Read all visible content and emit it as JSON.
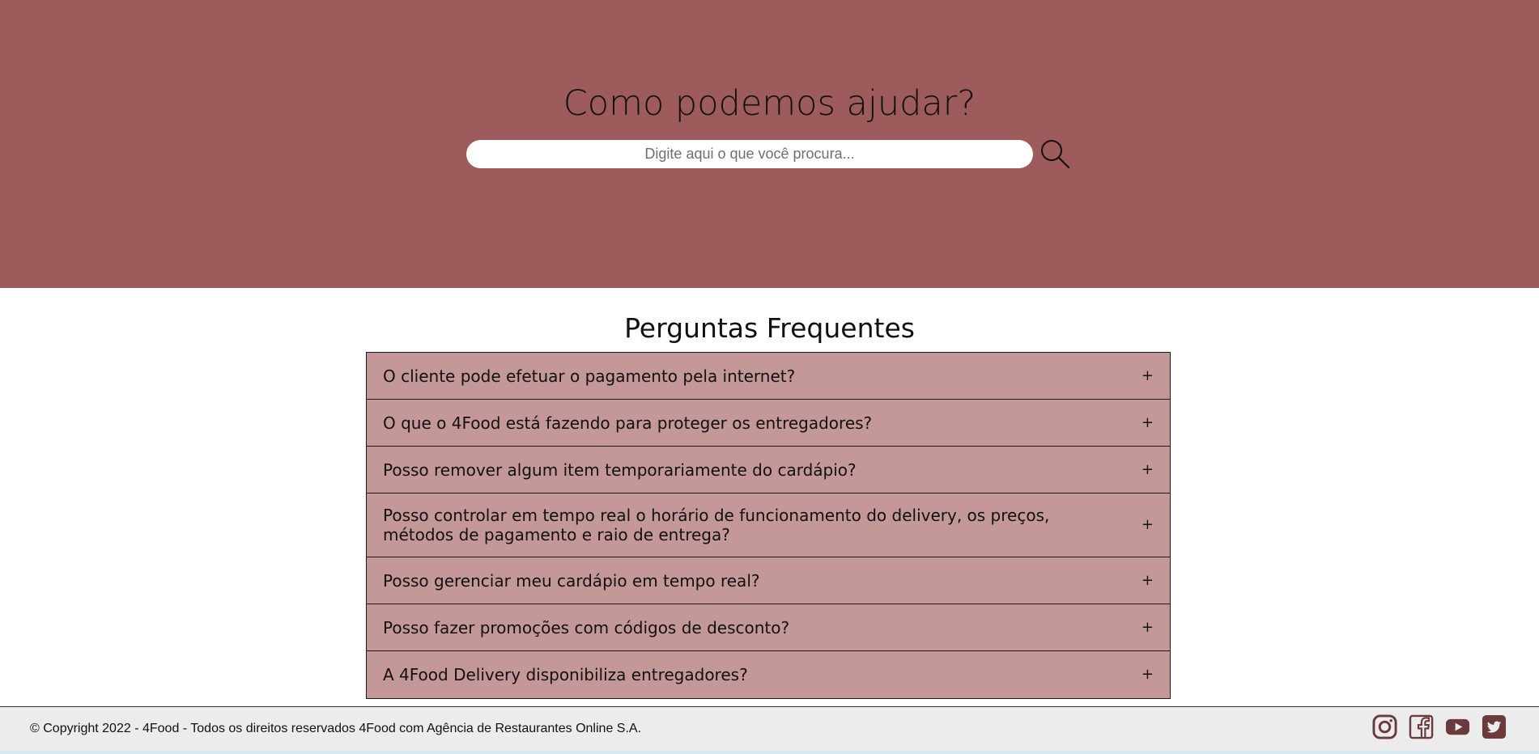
{
  "hero": {
    "title": "Como podemos ajudar?",
    "search_placeholder": "Digite aqui o que você procura...",
    "background_color": "#9d5b5b"
  },
  "faq": {
    "title": "Perguntas Frequentes",
    "expand_symbol": "+",
    "item_color": "#c49898",
    "items": [
      {
        "question": "O cliente pode efetuar o pagamento pela internet?"
      },
      {
        "question": "O que o 4Food está fazendo para proteger os entregadores?"
      },
      {
        "question": "Posso remover algum item temporariamente do cardápio?"
      },
      {
        "question": "Posso controlar em tempo real o horário de funcionamento do delivery, os preços, métodos de pagamento e raio de entrega?"
      },
      {
        "question": "Posso gerenciar meu cardápio em tempo real?"
      },
      {
        "question": "Posso fazer promoções com códigos de desconto?"
      },
      {
        "question": "A 4Food Delivery disponibiliza entregadores?"
      }
    ]
  },
  "footer": {
    "copyright": "© Copyright 2022 - 4Food - Todos os direitos reservados 4Food com Agência de Restaurantes Online S.A.",
    "socials": [
      "instagram-icon",
      "facebook-icon",
      "youtube-icon",
      "twitter-icon"
    ],
    "icon_color": "#6b3a3a"
  }
}
